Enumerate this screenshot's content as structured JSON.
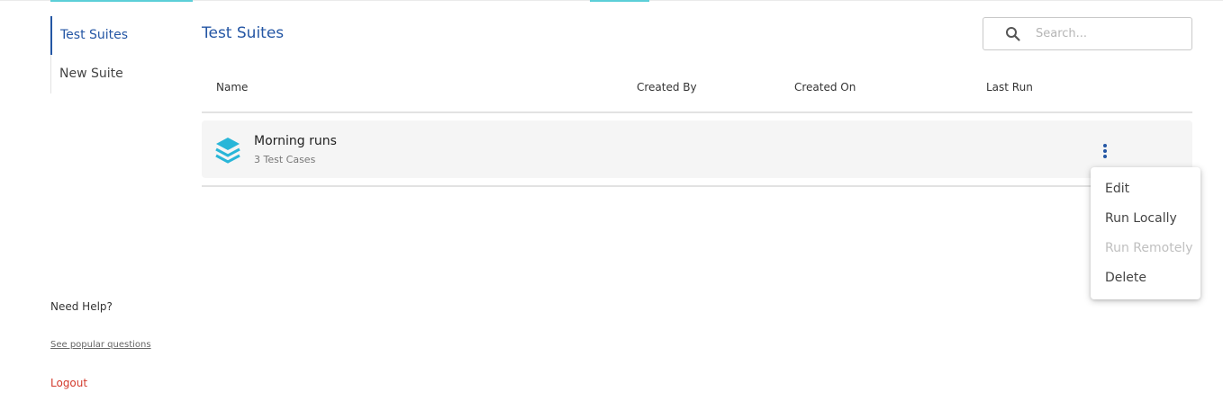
{
  "sidebar": {
    "items": [
      {
        "label": "Test Suites"
      },
      {
        "label": "New Suite"
      }
    ],
    "help_title": "Need Help?",
    "help_link": "See popular questions",
    "logout": "Logout"
  },
  "main": {
    "title": "Test Suites",
    "search": {
      "placeholder": "Search...",
      "value": ""
    },
    "columns": [
      "Name",
      "Created By",
      "Created On",
      "Last Run"
    ],
    "rows": [
      {
        "name": "Morning runs",
        "subtitle": "3 Test Cases",
        "icon": "layers-icon"
      }
    ]
  },
  "context_menu": {
    "items": [
      {
        "label": "Edit",
        "enabled": true
      },
      {
        "label": "Run Locally",
        "enabled": true
      },
      {
        "label": "Run Remotely",
        "enabled": false
      },
      {
        "label": "Delete",
        "enabled": true
      }
    ]
  },
  "colors": {
    "accent": "#2456a4",
    "teal": "#5ccfd8",
    "logout": "#d33a2c",
    "row_bg": "#f5f5f5"
  }
}
